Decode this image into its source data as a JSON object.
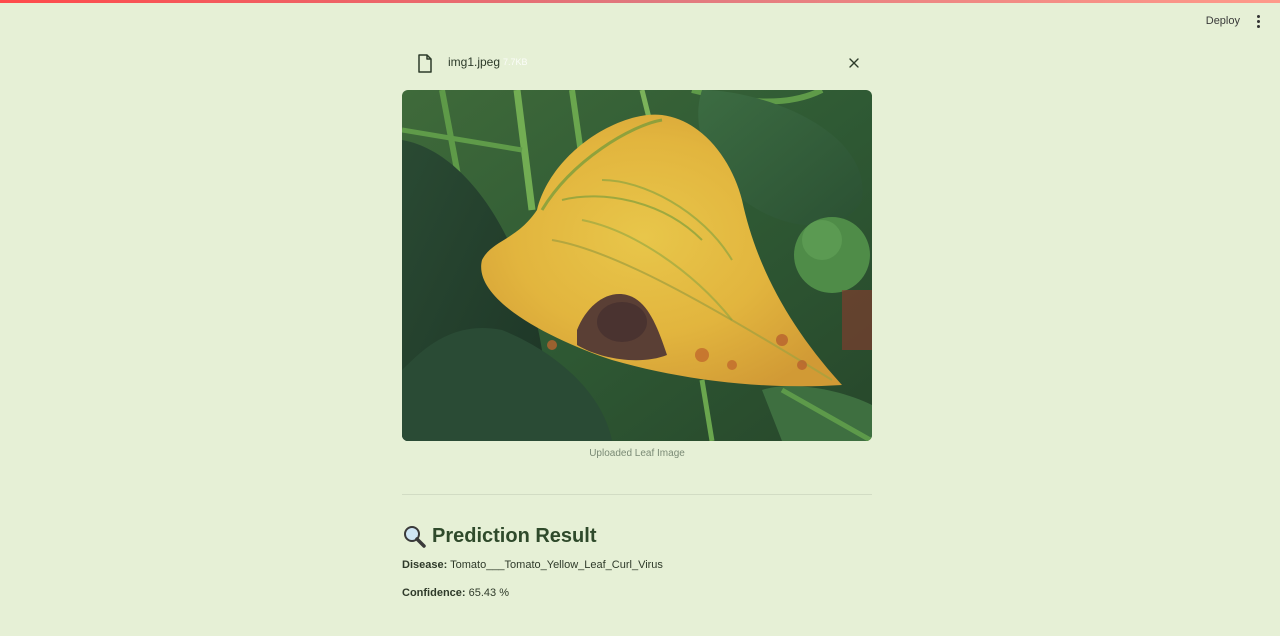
{
  "header": {
    "deploy_label": "Deploy"
  },
  "uploader": {
    "file_name": "img1.jpeg",
    "file_size": "7.7KB"
  },
  "image": {
    "caption": "Uploaded Leaf Image"
  },
  "result": {
    "title": "Prediction Result",
    "title_icon": "magnifier-emoji",
    "disease_label": "Disease:",
    "disease_value": "Tomato___Tomato_Yellow_Leaf_Curl_Virus",
    "confidence_label": "Confidence:",
    "confidence_value": "65.43 %"
  },
  "colors": {
    "background": "#e6f0d6",
    "accent_bar": "#ff4b4b",
    "title_text": "#2f4a2b"
  }
}
